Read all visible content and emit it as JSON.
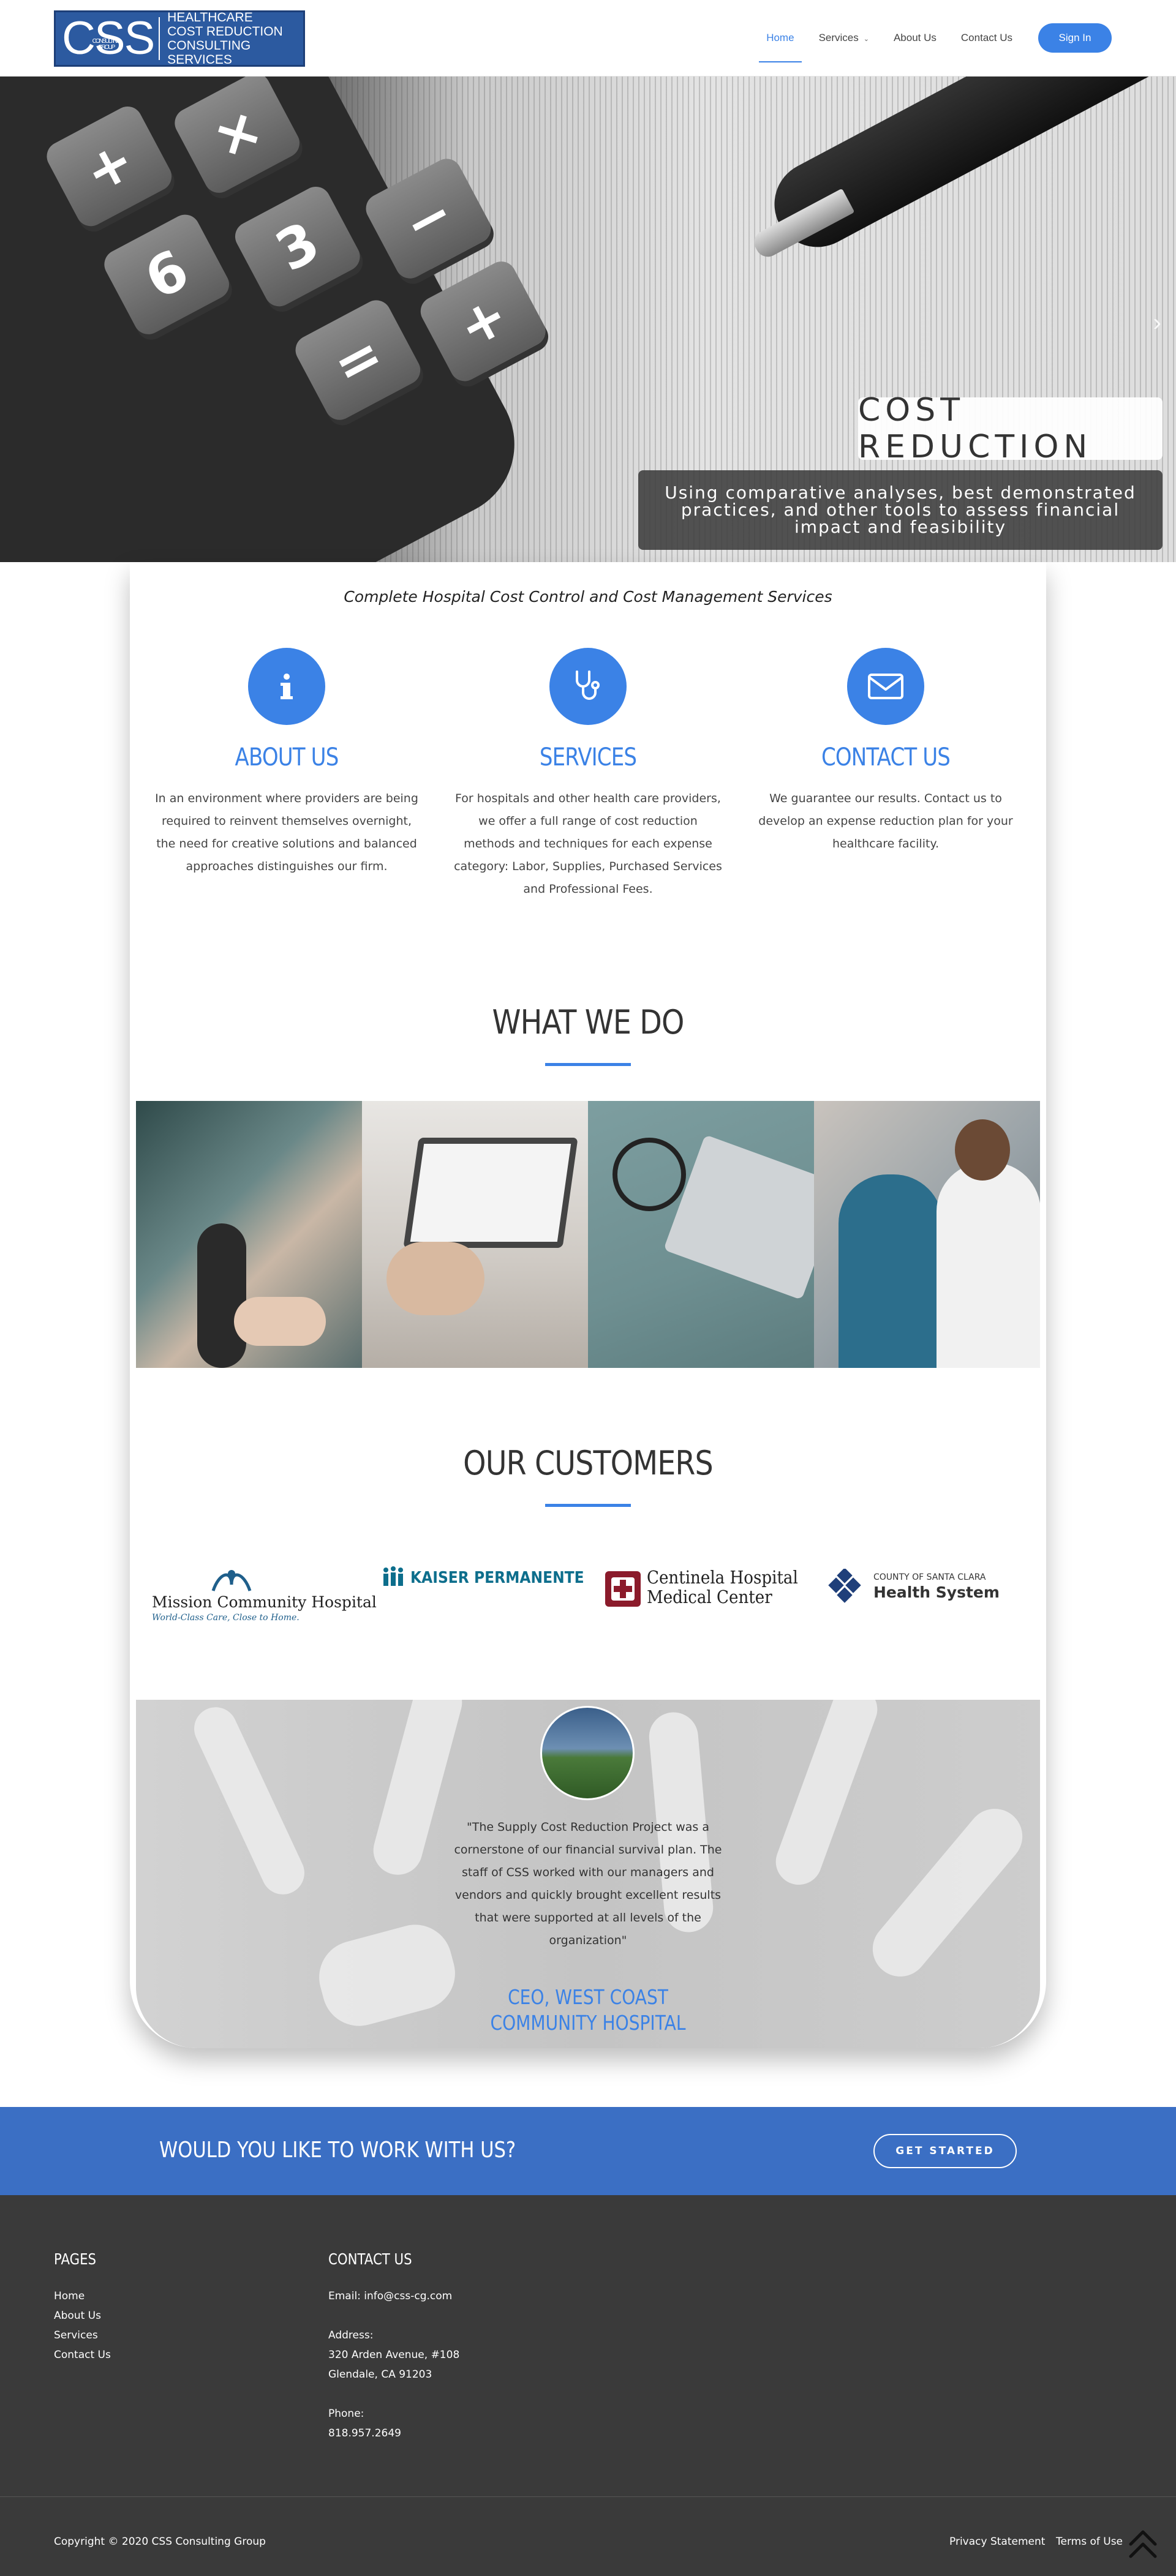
{
  "header": {
    "logo": {
      "big": "CSS",
      "small": "CONSULTING GROUP",
      "lines": [
        "HEALTHCARE",
        "COST REDUCTION",
        "CONSULTING SERVICES"
      ]
    },
    "nav": [
      {
        "label": "Home"
      },
      {
        "label": "Services"
      },
      {
        "label": "About Us"
      },
      {
        "label": "Contact Us"
      }
    ],
    "signin_label": "Sign In"
  },
  "hero": {
    "title": "COST REDUCTION",
    "caption": "Using comparative analyses, best demonstrated practices, and other tools to assess financial impact and feasibility",
    "calc_keys": [
      "+",
      "×",
      "6",
      "3",
      "−",
      "+",
      "="
    ],
    "arrow_icon": "chevron-right-icon"
  },
  "main": {
    "tagline": "Complete Hospital Cost Control and Cost Management Services",
    "features": [
      {
        "icon": "info-icon",
        "title": "ABOUT US",
        "text": "In an environment where providers are being required to reinvent themselves overnight, the need for creative solutions and balanced approaches distinguishes our firm."
      },
      {
        "icon": "stethoscope-icon",
        "title": "SERVICES",
        "text": "For hospitals and other health care providers, we offer a full range of cost reduction methods and techniques for each expense category: Labor, Supplies, Purchased Services and Professional Fees."
      },
      {
        "icon": "envelope-icon",
        "title": "CONTACT US",
        "text": "We guarantee our results. Contact us to develop an expense reduction plan for your healthcare facility."
      }
    ],
    "what_we_do_title": "WHAT WE DO",
    "customers_title": "OUR CUSTOMERS",
    "customers": [
      {
        "name": "Mission Community Hospital",
        "tagline": "World-Class Care, Close to Home."
      },
      {
        "name": "KAISER PERMANENTE"
      },
      {
        "name": "Centinela Hospital",
        "name2": "Medical Center"
      },
      {
        "name": "COUNTY OF SANTA CLARA",
        "name2": "Health System"
      }
    ],
    "testimonial": {
      "quote": "\"The Supply Cost Reduction Project was a cornerstone of our financial survival plan. The staff of CSS worked with our managers and vendors and quickly brought excellent results that were supported at all levels of the organization\"",
      "author": "CEO, WEST COAST COMMUNITY HOSPITAL"
    }
  },
  "cta": {
    "text": "WOULD YOU LIKE TO WORK WITH US?",
    "button": "GET STARTED"
  },
  "footer": {
    "pages_title": "PAGES",
    "pages": [
      "Home",
      "About Us",
      "Services",
      "Contact Us"
    ],
    "contact_title": "CONTACT US",
    "email": "Email: info@css-cg.com",
    "address_label": "Address:",
    "address_line1": "320 Arden Avenue, #108",
    "address_line2": "Glendale, CA 91203",
    "phone_label": "Phone:",
    "phone": "818.957.2649",
    "copyright": "Copyright © 2020 CSS Consulting Group",
    "links": [
      "Privacy Statement",
      "Terms of Use"
    ]
  },
  "colors": {
    "accent": "#3b82e6",
    "cta_band": "#3b6fc4",
    "footer_bg": "#3a3a3a",
    "logo_bg": "#2c5aa0"
  }
}
